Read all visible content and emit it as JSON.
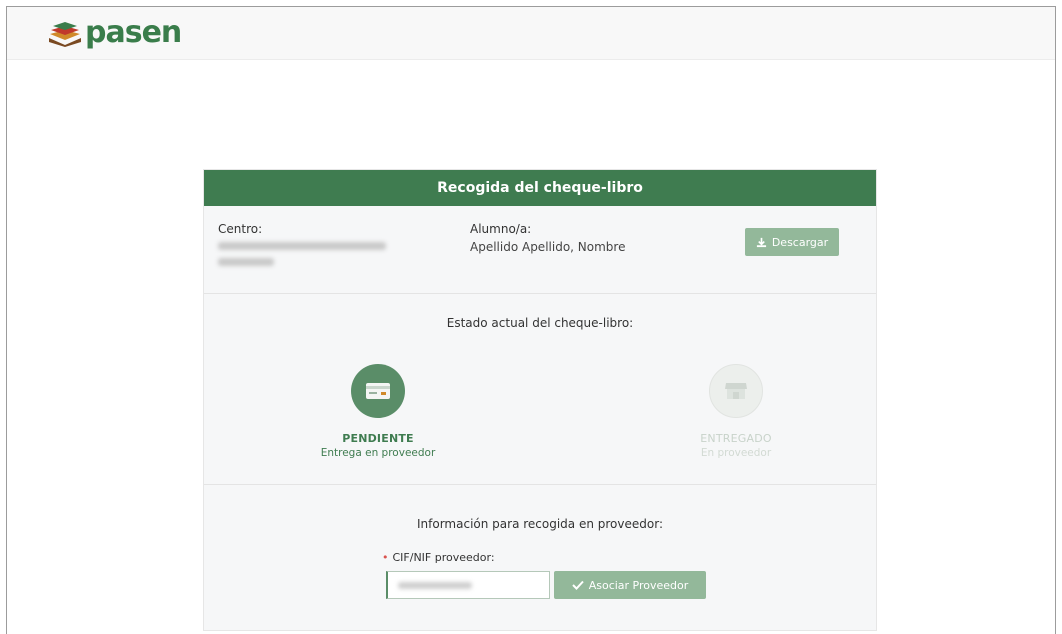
{
  "brand": {
    "name": "pasen",
    "color": "#3a7d4b"
  },
  "card": {
    "title": "Recogida del cheque-libro",
    "centro_label": "Centro:",
    "alumno_label": "Alumno/a:",
    "alumno_value": "Apellido Apellido, Nombre",
    "download_label": "Descargar",
    "status_title": "Estado actual del cheque-libro:",
    "steps": [
      {
        "name": "PENDIENTE",
        "sub": "Entrega en proveedor",
        "icon": "card-icon",
        "active": true
      },
      {
        "name": "ENTREGADO",
        "sub": "En proveedor",
        "icon": "store-icon",
        "active": false
      }
    ],
    "pickup_title": "Información para recogida en proveedor:",
    "cif_label": "CIF/NIF proveedor:",
    "associate_label": "Asociar Proveedor"
  },
  "colors": {
    "header_green": "#3f7c50",
    "button_green": "#93b89a",
    "active_step": "#5a8d68",
    "inactive_step": "#ecefec"
  }
}
